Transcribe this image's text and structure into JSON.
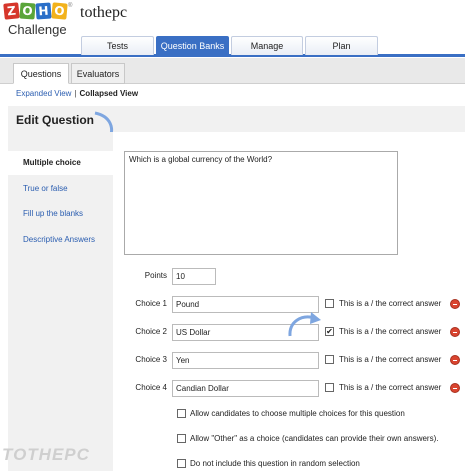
{
  "brand": {
    "logo_letters": [
      "Z",
      "O",
      "H",
      "O"
    ],
    "logo_tm": "®",
    "logo_subtitle": "Challenge",
    "org_name": "tothepc"
  },
  "top_nav": {
    "tabs": [
      {
        "label": "Tests",
        "active": false
      },
      {
        "label": "Question Banks",
        "active": true
      },
      {
        "label": "Manage",
        "active": false
      },
      {
        "label": "Plan",
        "active": false
      }
    ]
  },
  "sub_nav": {
    "tabs": [
      {
        "label": "Questions",
        "active": true
      },
      {
        "label": "Evaluators",
        "active": false
      }
    ]
  },
  "view_links": {
    "expanded": "Expanded View",
    "separator": "|",
    "collapsed": "Collapsed View"
  },
  "editor": {
    "title": "Edit Question",
    "question_types": [
      {
        "label": "Multiple choice",
        "active": true
      },
      {
        "label": "True or false",
        "active": false
      },
      {
        "label": "Fill up the blanks",
        "active": false
      },
      {
        "label": "Descriptive Answers",
        "active": false
      }
    ],
    "question_text": "Which is a global currency of the World?",
    "points_label": "Points",
    "points_value": "10",
    "choices": [
      {
        "label": "Choice 1",
        "value": "Pound",
        "correct": false
      },
      {
        "label": "Choice 2",
        "value": "US Dollar",
        "correct": true
      },
      {
        "label": "Choice 3",
        "value": "Yen",
        "correct": false
      },
      {
        "label": "Choice 4",
        "value": "Candian Dollar",
        "correct": false
      }
    ],
    "correct_answer_label": "This is a / the correct answer",
    "options": [
      {
        "label": "Allow candidates to choose multiple choices for this question",
        "checked": false
      },
      {
        "label": "Allow \"Other\" as a choice (candidates can provide their own answers).",
        "checked": false
      },
      {
        "label": "Do not include this question in random selection",
        "checked": false
      }
    ]
  },
  "icons": {
    "remove_choice": "remove-circle-icon",
    "arrow": "curved-arrow-icon"
  },
  "colors": {
    "accent": "#3a6fc4",
    "link": "#2a5db0",
    "remove": "#d9442f",
    "panel_bg": "#f1f1f1"
  },
  "watermark": "TOTHEPC"
}
